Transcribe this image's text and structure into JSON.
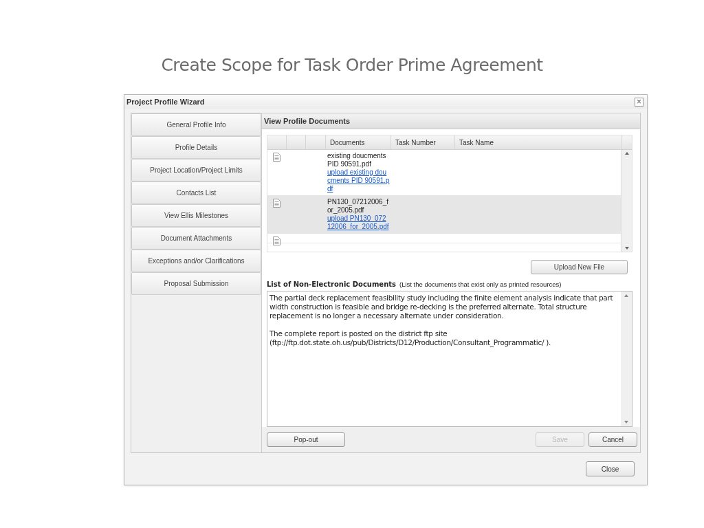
{
  "slide_title": "Create Scope for Task Order Prime Agreement",
  "dialog": {
    "title": "Project Profile Wizard",
    "close_icon": "×"
  },
  "nav": [
    {
      "label": "General Profile Info"
    },
    {
      "label": "Profile Details"
    },
    {
      "label": "Project Location/Project Limits"
    },
    {
      "label": "Contacts List"
    },
    {
      "label": "View Ellis Milestones"
    },
    {
      "label": "Document Attachments"
    },
    {
      "label": "Exceptions and/or Clarifications"
    },
    {
      "label": "Proposal Submission"
    }
  ],
  "panel": {
    "title": "View Profile Documents",
    "table": {
      "columns": [
        "Documents",
        "Task Number",
        "Task Name"
      ],
      "rows": [
        {
          "document": "existing doucments PID 90591.pdf",
          "link": "upload existing doucments PID 90591.pdf",
          "selected": false
        },
        {
          "document": "PN130_07212006_for_2005.pdf",
          "link": "upload PN130_07212006_for_2005.pdf",
          "selected": true
        },
        {
          "selected": false
        }
      ]
    },
    "upload_button": "Upload New File",
    "notes_label": "List of Non-Electronic Documents",
    "notes_hint": "(List the documents that exist only as printed resources)",
    "notes_text": "The partial deck replacement feasibility study including the finite element analysis indicate that part width construction is feasible and bridge re-decking is the preferred alternate. Total structure replacement is no longer a necessary alternate under consideration.\n\nThe complete report is posted on the district ftp site (ftp://ftp.dot.state.oh.us/pub/Districts/D12/Production/Consultant_Programmatic/ ).",
    "left_buttons": [
      {
        "label": "Pop-out",
        "disabled": false
      }
    ],
    "right_buttons": [
      {
        "label": "Save",
        "disabled": true
      },
      {
        "label": "Cancel",
        "disabled": false
      }
    ]
  },
  "footer_button": "Close"
}
